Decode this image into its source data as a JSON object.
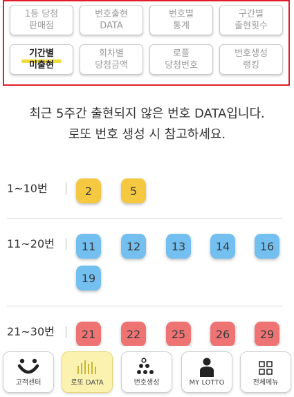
{
  "menu": {
    "items": [
      {
        "label": "1등 당첨\n판매점",
        "active": false
      },
      {
        "label": "번호출현\nDATA",
        "active": false
      },
      {
        "label": "번호별\n통계",
        "active": false
      },
      {
        "label": "구간별\n출현횟수",
        "active": false
      },
      {
        "label": "기간별\n미출현",
        "active": true
      },
      {
        "label": "회차별\n당첨금액",
        "active": false
      },
      {
        "label": "로플\n당첨번호",
        "active": false
      },
      {
        "label": "번호생성\n랭킹",
        "active": false
      }
    ]
  },
  "intro": {
    "line1": "최근 5주간 출현되지 않은 번호 DATA입니다.",
    "line2": "로또 번호 생성 시 참고하세요."
  },
  "groups": [
    {
      "label": "1~10번",
      "color": "#f5c842",
      "numbers": [
        "2",
        "5"
      ]
    },
    {
      "label": "11~20번",
      "color": "#72bff0",
      "numbers": [
        "11",
        "12",
        "13",
        "14",
        "16",
        "19"
      ]
    },
    {
      "label": "21~30번",
      "color": "#ee7474",
      "numbers": [
        "21",
        "22",
        "25",
        "26",
        "29"
      ]
    }
  ],
  "nav": {
    "items": [
      {
        "label": "고객센터",
        "icon": "smile-icon",
        "active": false
      },
      {
        "label": "로또 DATA",
        "icon": "bar-chart-icon",
        "active": true
      },
      {
        "label": "번호생성",
        "icon": "dots-triangle-icon",
        "active": false
      },
      {
        "label": "MY LOTTO",
        "icon": "person-icon",
        "active": false
      },
      {
        "label": "전체메뉴",
        "icon": "grid-menu-icon",
        "active": false
      }
    ]
  }
}
